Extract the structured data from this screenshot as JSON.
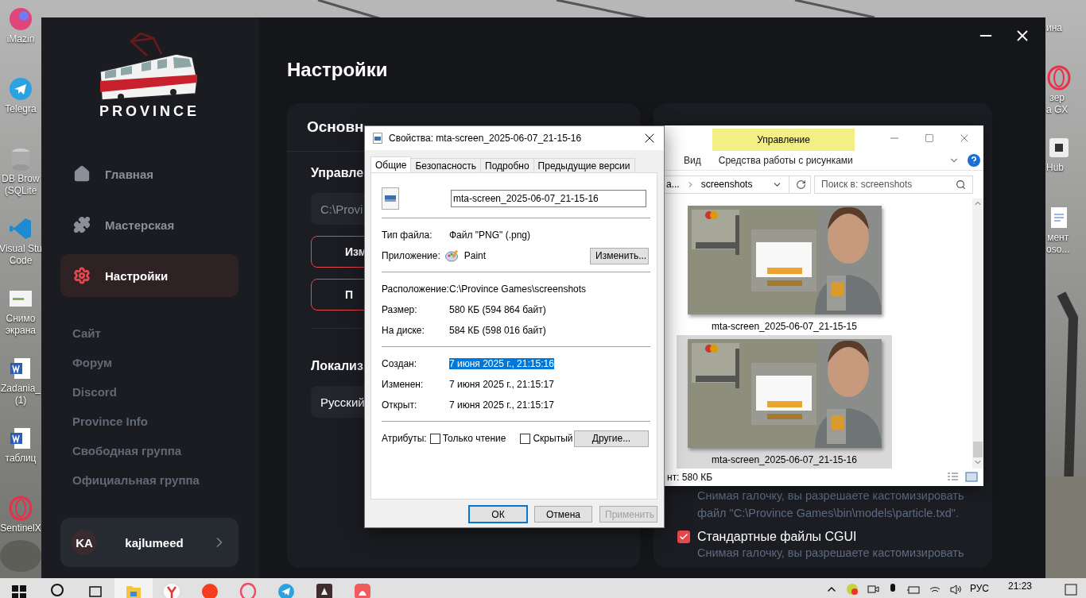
{
  "desktop": {
    "left_icons": [
      {
        "kind": "imazing",
        "label": "iMazin"
      },
      {
        "kind": "telegram",
        "label": "Telegra"
      },
      {
        "kind": "database",
        "label": "DB Brow\n(SQLite"
      },
      {
        "kind": "vscode",
        "label": "Visual Stu\nCode"
      },
      {
        "kind": "screenshot",
        "label": "Снимо\nэкрана"
      },
      {
        "kind": "word",
        "label": "Zadania_\n(1)"
      },
      {
        "kind": "word",
        "label": "таблиц"
      },
      {
        "kind": "opera",
        "label": "SentinelX"
      }
    ],
    "right_icons": [
      {
        "kind": "blank",
        "label": "ина"
      },
      {
        "kind": "opera",
        "label": "зер\na GX"
      },
      {
        "kind": "app",
        "label": "Hub"
      },
      {
        "kind": "document",
        "label": "мент\noso..."
      }
    ]
  },
  "launcher": {
    "logo": "PROVINCE",
    "nav": [
      {
        "kind": "home",
        "label": "Главная",
        "selected": false
      },
      {
        "kind": "workshop",
        "label": "Мастерская",
        "selected": false
      },
      {
        "kind": "settings",
        "label": "Настройки",
        "selected": true
      }
    ],
    "links": [
      "Сайт",
      "Форум",
      "Discord",
      "Province Info",
      "Свободная группа",
      "Официальная группа"
    ],
    "user": {
      "initials": "KA",
      "name": "kajlumeed"
    },
    "title": "Настройки",
    "main_card": {
      "title": "Основн",
      "path_section": "Управле",
      "path_value": "C:\\Provi",
      "buttons": [
        "Изм",
        "П"
      ],
      "locale_section": "Локализ",
      "locale_value": "Русский"
    },
    "extra_card": {
      "note": "Снимая галочку, вы разрешаете кастомизировать файл \"C:\\Province Games\\bin\\models\\particle.txd\".",
      "options": [
        {
          "label": "Стандартные файлы CGUI",
          "checked": true,
          "description": "Снимая галочку, вы разрешаете кастомизировать"
        }
      ]
    }
  },
  "properties_dialog": {
    "title": "Свойства: mta-screen_2025-06-07_21-15-16",
    "tabs": [
      {
        "label": "Общие",
        "selected": true
      },
      {
        "label": "Безопасность",
        "selected": false
      },
      {
        "label": "Подробно",
        "selected": false
      },
      {
        "label": "Предыдущие версии",
        "selected": false
      }
    ],
    "file_name": "mta-screen_2025-06-07_21-15-16",
    "groups": [
      [
        {
          "kind": "text",
          "label": "Тип файла:",
          "value": "Файл \"PNG\" (.png)",
          "selected": false
        },
        {
          "kind": "app",
          "label": "Приложение:",
          "value": "Paint",
          "button": "Изменить...",
          "selected": false
        }
      ],
      [
        {
          "kind": "text",
          "label": "Расположение:",
          "value": "C:\\Province Games\\screenshots",
          "selected": false
        },
        {
          "kind": "text",
          "label": "Размер:",
          "value": "580 КБ (594 864 байт)",
          "selected": false
        },
        {
          "kind": "text",
          "label": "На диске:",
          "value": "584 КБ (598 016 байт)",
          "selected": false
        }
      ],
      [
        {
          "kind": "text",
          "label": "Создан:",
          "value": "7 июня 2025 г., 21:15:16",
          "selected": true
        },
        {
          "kind": "text",
          "label": "Изменен:",
          "value": "7 июня 2025 г., 21:15:17",
          "selected": false
        },
        {
          "kind": "text",
          "label": "Открыт:",
          "value": "7 июня 2025 г., 21:15:17",
          "selected": false
        }
      ]
    ],
    "attributes": {
      "label": "Атрибуты:",
      "checks": [
        {
          "label": "Только чтение",
          "checked": false
        },
        {
          "label": "Скрытый",
          "checked": false
        }
      ],
      "button": "Другие..."
    },
    "buttons": [
      {
        "label": "ОК",
        "default": true,
        "disabled": false
      },
      {
        "label": "Отмена",
        "default": false,
        "disabled": false
      },
      {
        "label": "Применить",
        "default": false,
        "disabled": true
      }
    ]
  },
  "explorer": {
    "context_tab": "Управление",
    "ribbon_tabs": [
      "Вид",
      "Средства работы с рисунками"
    ],
    "address": {
      "parent": "a...",
      "folder": "screenshots"
    },
    "search": {
      "placeholder": "Поиск в: screenshots"
    },
    "files": [
      {
        "name": "mta-screen_2025-06-07_21-15-15",
        "selected": false
      },
      {
        "name": "mta-screen_2025-06-07_21-15-16",
        "selected": true
      }
    ],
    "status": "нт: 580 КБ"
  },
  "taskbar": {
    "apps": [
      {
        "kind": "start",
        "selected": false
      },
      {
        "kind": "search",
        "selected": false
      },
      {
        "kind": "taskview",
        "selected": false
      },
      {
        "kind": "explorer",
        "selected": true
      },
      {
        "kind": "yandex-browser",
        "selected": false
      },
      {
        "kind": "yandex",
        "selected": false
      },
      {
        "kind": "opera",
        "selected": false
      },
      {
        "kind": "telegram",
        "selected": false
      },
      {
        "kind": "dark-app",
        "selected": false
      },
      {
        "kind": "red-app",
        "selected": false
      }
    ],
    "language": "РУС",
    "time": "21:23"
  }
}
